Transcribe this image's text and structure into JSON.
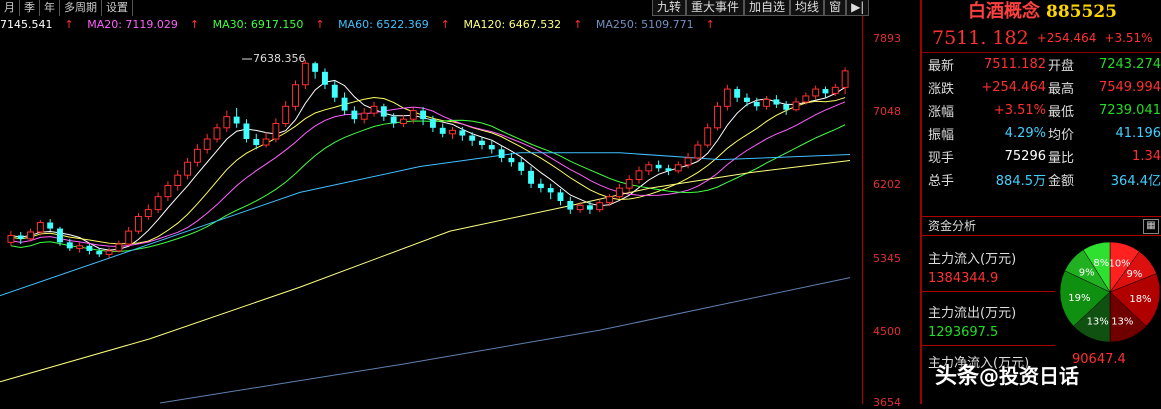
{
  "toolbar": {
    "left_items": [
      "月",
      "季",
      "年",
      "多周期",
      "设置"
    ],
    "right_items": [
      "九转",
      "重大事件",
      "加自选",
      "均线",
      "窗",
      "▶|"
    ]
  },
  "ma_legend": [
    {
      "label": "7145.541",
      "color": "#ffffff"
    },
    {
      "label": "MA20: 7119.029",
      "color": "#ff60ff"
    },
    {
      "label": "MA30: 6917.150",
      "color": "#40ff40"
    },
    {
      "label": "MA60: 6522.369",
      "color": "#40c0ff"
    },
    {
      "label": "MA120: 6467.532",
      "color": "#ffff80"
    },
    {
      "label": "MA250: 5109.771",
      "color": "#7090c0"
    }
  ],
  "price_axis": [
    "7893",
    "7048",
    "6202",
    "5345",
    "4500",
    "3654"
  ],
  "peak_label": "7638.356",
  "panel": {
    "name": "白酒概念",
    "code": "885525",
    "price": "7511. 182",
    "change": "+254.464",
    "change_pct": "+3.51%",
    "rows": [
      {
        "l1": "最新",
        "v1": "7511.182",
        "c1": "red",
        "l2": "开盘",
        "v2": "7243.274",
        "c2": "green"
      },
      {
        "l1": "涨跌",
        "v1": "+254.464",
        "c1": "red",
        "l2": "最高",
        "v2": "7549.994",
        "c2": "red"
      },
      {
        "l1": "涨幅",
        "v1": "+3.51%",
        "c1": "red",
        "l2": "最低",
        "v2": "7239.041",
        "c2": "green"
      },
      {
        "l1": "振幅",
        "v1": "4.29%",
        "c1": "cyan",
        "l2": "均价",
        "v2": "41.196",
        "c2": "cyan"
      },
      {
        "l1": "现手",
        "v1": "75296",
        "c1": "white",
        "l2": "量比",
        "v2": "1.34",
        "c2": "red"
      },
      {
        "l1": "总手",
        "v1": "884.5万",
        "c1": "cyan",
        "l2": "金额",
        "v2": "364.4亿",
        "c2": "cyan"
      }
    ]
  },
  "fund": {
    "title": "资金分析",
    "icon": "grid-icon",
    "inflow_label": "主力流入(万元)",
    "inflow_value": "1384344.9",
    "outflow_label": "主力流出(万元)",
    "outflow_value": "1293697.5",
    "net_label": "主力净流入(万元)",
    "net_value": "90647.4",
    "pie": [
      {
        "label": "10%",
        "value": 10,
        "color": "#ff2020"
      },
      {
        "label": "9%",
        "value": 9,
        "color": "#dd1010"
      },
      {
        "label": "18%",
        "value": 18,
        "color": "#b00000"
      },
      {
        "label": "13%",
        "value": 13,
        "color": "#700000"
      },
      {
        "label": "13%",
        "value": 13,
        "color": "#105010"
      },
      {
        "label": "19%",
        "value": 19,
        "color": "#109010"
      },
      {
        "label": "9%",
        "value": 9,
        "color": "#20b020"
      },
      {
        "label": "8%",
        "value": 9,
        "color": "#30e030"
      }
    ]
  },
  "watermark": {
    "prefix": "头条",
    "handle": "@投资日话"
  },
  "chart_data": {
    "type": "candlestick",
    "ylim": [
      3654,
      7893
    ],
    "y_ticks": [
      7893,
      7048,
      6202,
      5345,
      4500,
      3654
    ],
    "candles": [
      [
        5520,
        5600,
        5650,
        5480
      ],
      [
        5600,
        5560,
        5640,
        5500
      ],
      [
        5560,
        5640,
        5680,
        5530
      ],
      [
        5640,
        5750,
        5780,
        5600
      ],
      [
        5750,
        5680,
        5790,
        5650
      ],
      [
        5680,
        5520,
        5700,
        5480
      ],
      [
        5520,
        5450,
        5560,
        5420
      ],
      [
        5450,
        5480,
        5520,
        5400
      ],
      [
        5480,
        5420,
        5500,
        5380
      ],
      [
        5420,
        5380,
        5450,
        5350
      ],
      [
        5380,
        5420,
        5460,
        5340
      ],
      [
        5420,
        5500,
        5540,
        5400
      ],
      [
        5500,
        5650,
        5700,
        5480
      ],
      [
        5650,
        5820,
        5860,
        5620
      ],
      [
        5820,
        5900,
        5960,
        5780
      ],
      [
        5900,
        6050,
        6100,
        5860
      ],
      [
        6050,
        6180,
        6230,
        6000
      ],
      [
        6180,
        6300,
        6360,
        6120
      ],
      [
        6300,
        6450,
        6500,
        6250
      ],
      [
        6450,
        6600,
        6660,
        6400
      ],
      [
        6600,
        6720,
        6780,
        6550
      ],
      [
        6720,
        6850,
        6900,
        6680
      ],
      [
        6850,
        6980,
        7050,
        6800
      ],
      [
        6980,
        6900,
        7080,
        6850
      ],
      [
        6900,
        6720,
        6950,
        6680
      ],
      [
        6720,
        6650,
        6780,
        6600
      ],
      [
        6650,
        6720,
        6800,
        6620
      ],
      [
        6720,
        6900,
        6960,
        6680
      ],
      [
        6900,
        7100,
        7160,
        6860
      ],
      [
        7100,
        7350,
        7400,
        7050
      ],
      [
        7350,
        7600,
        7638,
        7300
      ],
      [
        7600,
        7500,
        7620,
        7420
      ],
      [
        7500,
        7350,
        7540,
        7300
      ],
      [
        7350,
        7200,
        7400,
        7150
      ],
      [
        7200,
        7050,
        7260,
        7000
      ],
      [
        7050,
        6950,
        7100,
        6900
      ],
      [
        6950,
        7020,
        7080,
        6900
      ],
      [
        7020,
        7100,
        7150,
        6980
      ],
      [
        7100,
        6980,
        7130,
        6930
      ],
      [
        6980,
        6900,
        7020,
        6850
      ],
      [
        6900,
        6950,
        7000,
        6860
      ],
      [
        6950,
        7050,
        7080,
        6900
      ],
      [
        7050,
        6950,
        7090,
        6880
      ],
      [
        6950,
        6850,
        6990,
        6800
      ],
      [
        6850,
        6780,
        6900,
        6740
      ],
      [
        6780,
        6820,
        6860,
        6720
      ],
      [
        6820,
        6760,
        6860,
        6700
      ],
      [
        6760,
        6700,
        6800,
        6640
      ],
      [
        6700,
        6650,
        6740,
        6600
      ],
      [
        6650,
        6600,
        6700,
        6550
      ],
      [
        6600,
        6500,
        6640,
        6450
      ],
      [
        6500,
        6450,
        6560,
        6400
      ],
      [
        6450,
        6350,
        6500,
        6300
      ],
      [
        6350,
        6200,
        6400,
        6150
      ],
      [
        6200,
        6150,
        6260,
        6100
      ],
      [
        6150,
        6100,
        6200,
        6020
      ],
      [
        6100,
        6000,
        6140,
        5950
      ],
      [
        6000,
        5900,
        6050,
        5850
      ],
      [
        5900,
        5950,
        5990,
        5860
      ],
      [
        5950,
        5900,
        6000,
        5850
      ],
      [
        5900,
        5980,
        6020,
        5870
      ],
      [
        5980,
        6050,
        6080,
        5940
      ],
      [
        6050,
        6150,
        6200,
        6020
      ],
      [
        6150,
        6250,
        6300,
        6100
      ],
      [
        6250,
        6350,
        6400,
        6200
      ],
      [
        6350,
        6420,
        6460,
        6300
      ],
      [
        6420,
        6380,
        6470,
        6340
      ],
      [
        6380,
        6350,
        6420,
        6300
      ],
      [
        6350,
        6420,
        6460,
        6320
      ],
      [
        6420,
        6500,
        6560,
        6380
      ],
      [
        6500,
        6650,
        6700,
        6460
      ],
      [
        6650,
        6850,
        6900,
        6620
      ],
      [
        6850,
        7100,
        7150,
        6820
      ],
      [
        7100,
        7300,
        7350,
        7050
      ],
      [
        7300,
        7200,
        7330,
        7150
      ],
      [
        7200,
        7150,
        7250,
        7100
      ],
      [
        7150,
        7100,
        7200,
        7050
      ],
      [
        7100,
        7180,
        7220,
        7060
      ],
      [
        7180,
        7120,
        7230,
        7080
      ],
      [
        7120,
        7060,
        7160,
        7000
      ],
      [
        7060,
        7150,
        7200,
        7040
      ],
      [
        7150,
        7220,
        7260,
        7120
      ],
      [
        7220,
        7300,
        7340,
        7180
      ],
      [
        7300,
        7250,
        7330,
        7200
      ],
      [
        7250,
        7320,
        7360,
        7220
      ],
      [
        7320,
        7511,
        7550,
        7239
      ]
    ]
  }
}
